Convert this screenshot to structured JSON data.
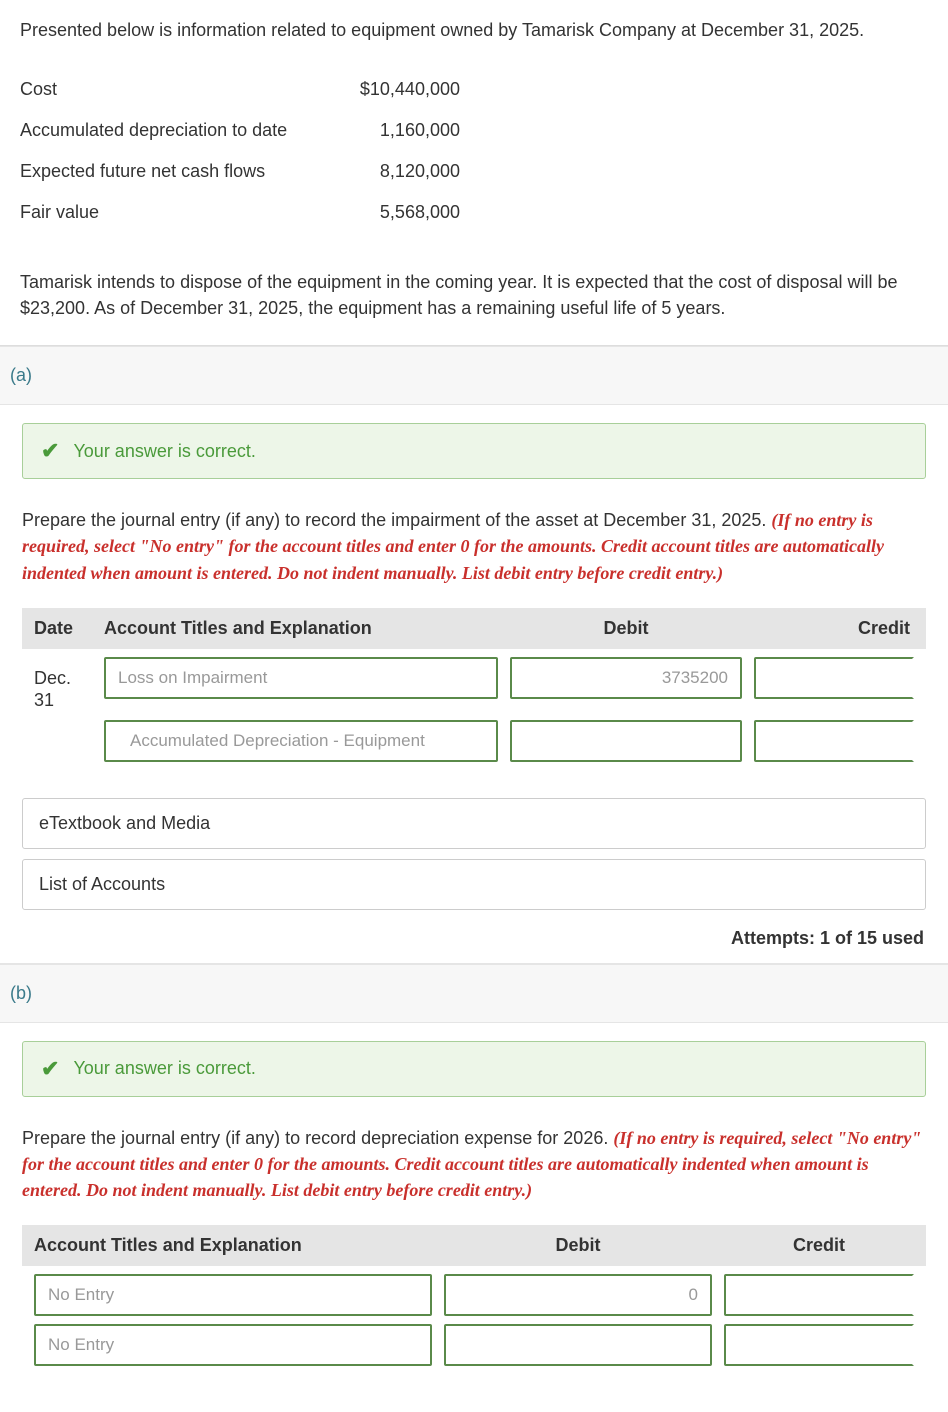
{
  "intro": "Presented below is information related to equipment owned by Tamarisk Company at December 31, 2025.",
  "data_rows": [
    {
      "label": "Cost",
      "value": "$10,440,000"
    },
    {
      "label": "Accumulated depreciation to date",
      "value": "1,160,000"
    },
    {
      "label": "Expected future net cash flows",
      "value": "8,120,000"
    },
    {
      "label": "Fair value",
      "value": "5,568,000"
    }
  ],
  "follow": "Tamarisk intends to dispose of the equipment in the coming year. It is expected that the cost of disposal will be $23,200. As of December 31, 2025, the equipment has a remaining useful life of 5 years.",
  "part_a": {
    "label": "(a)",
    "correct_msg": "Your answer is correct.",
    "instr_plain": "Prepare the journal entry (if any) to record the impairment of the asset at December 31, 2025. ",
    "instr_red": "(If no entry is required, select \"No entry\" for the account titles and enter 0 for the amounts. Credit account titles are automatically indented when amount is entered. Do not indent manually. List debit entry before credit entry.)",
    "headers": {
      "date": "Date",
      "acct": "Account Titles and Explanation",
      "debit": "Debit",
      "credit": "Credit"
    },
    "row1": {
      "date1": "Dec.",
      "date2": "31",
      "acct": "Loss on Impairment",
      "debit": "3735200",
      "credit": ""
    },
    "row2": {
      "acct": "Accumulated Depreciation - Equipment",
      "debit": "",
      "credit": ""
    },
    "etext": "eTextbook and Media",
    "loa": "List of Accounts",
    "attempts": "Attempts: 1 of 15 used"
  },
  "part_b": {
    "label": "(b)",
    "correct_msg": "Your answer is correct.",
    "instr_plain": "Prepare the journal entry (if any) to record depreciation expense for 2026. ",
    "instr_red": "(If no entry is required, select \"No entry\" for the account titles and enter 0 for the amounts. Credit account titles are automatically indented when amount is entered. Do not indent manually. List debit entry before credit entry.)",
    "headers": {
      "acct": "Account Titles and Explanation",
      "debit": "Debit",
      "credit": "Credit"
    },
    "row1": {
      "acct": "No Entry",
      "debit": "0",
      "credit": ""
    },
    "row2": {
      "acct": "No Entry",
      "debit": "",
      "credit": ""
    }
  }
}
